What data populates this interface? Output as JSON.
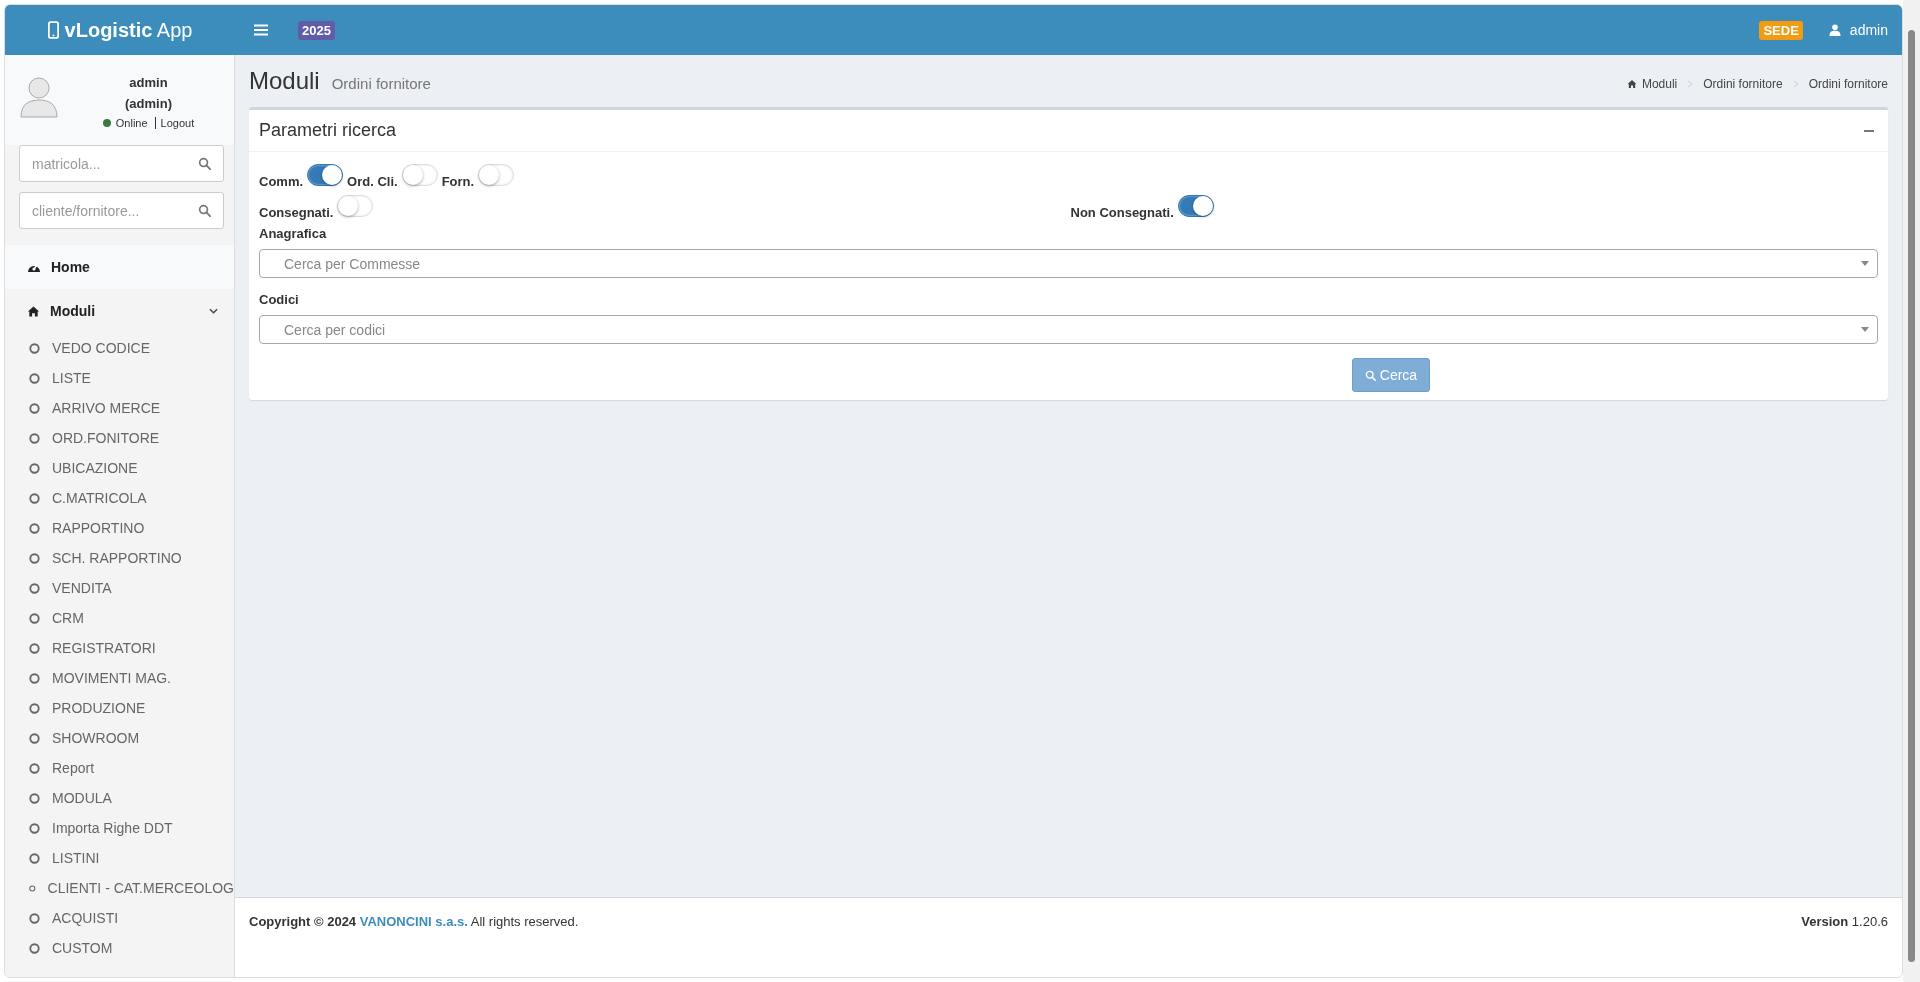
{
  "header": {
    "logo_bold": "vLogistic",
    "logo_light": "App",
    "year_badge": "2025",
    "site_badge": "SEDE",
    "user": "admin"
  },
  "sidebar": {
    "user_name": "admin",
    "user_role": "(admin)",
    "status": "Online",
    "logout": "Logout",
    "searches": [
      {
        "placeholder": "matricola..."
      },
      {
        "placeholder": "cliente/fornitore..."
      }
    ],
    "nav": [
      {
        "label": "Home",
        "kind": "home",
        "expanded": false
      },
      {
        "label": "Moduli",
        "kind": "modules",
        "expanded": true
      }
    ],
    "items": [
      "VEDO CODICE",
      "LISTE",
      "ARRIVO MERCE",
      "ORD.FONITORE",
      "UBICAZIONE",
      "C.MATRICOLA",
      "RAPPORTINO",
      "SCH. RAPPORTINO",
      "VENDITA",
      "CRM",
      "REGISTRATORI",
      "MOVIMENTI MAG.",
      "PRODUZIONE",
      "SHOWROOM",
      "Report",
      "MODULA",
      "Importa Righe DDT",
      "LISTINI",
      "CLIENTI - CAT.MERCEOLOG",
      "ACQUISTI",
      "CUSTOM"
    ]
  },
  "page": {
    "title": "Moduli",
    "subtitle": "Ordini fornitore",
    "breadcrumb": [
      "Moduli",
      "Ordini fornitore",
      "Ordini fornitore"
    ]
  },
  "panel": {
    "title": "Parametri ricerca",
    "toggle_rows": [
      [
        {
          "label": "Comm.",
          "on": true
        },
        {
          "label": "Ord. Cli.",
          "on": false
        },
        {
          "label": "Forn.",
          "on": false
        }
      ],
      [
        {
          "label": "Consegnati.",
          "on": false
        },
        {
          "label": "Non Consegnati.",
          "on": true
        }
      ]
    ],
    "selects": [
      {
        "label": "Anagrafica",
        "placeholder": "Cerca per Commesse"
      },
      {
        "label": "Codici",
        "placeholder": "Cerca per codici"
      }
    ],
    "button": "Cerca"
  },
  "footer": {
    "copyright": "Copyright © 2024",
    "company": "VANONCINI s.a.s.",
    "rights": "All rights reserved.",
    "version_label": "Version",
    "version": "1.20.6"
  }
}
